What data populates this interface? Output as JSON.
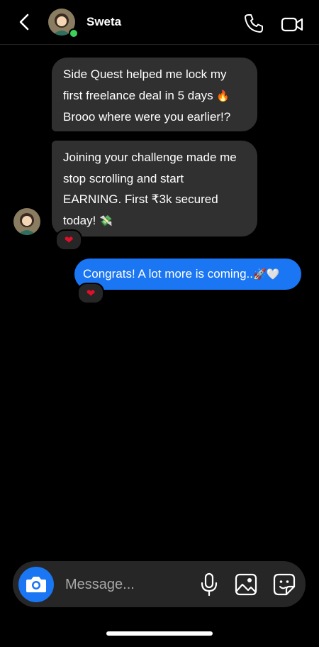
{
  "header": {
    "contact_name": "Sweta"
  },
  "messages": [
    {
      "lines": [
        "Side Quest helped me lock my",
        "first freelance deal in 5 days",
        "Brooo where were you earlier!?"
      ],
      "emoji_line1": "🔥"
    },
    {
      "lines": [
        "Joining your challenge made me",
        "stop scrolling and start",
        "EARNING. First ₹3k secured",
        "today!"
      ],
      "emoji_last": "💸",
      "reaction": "❤"
    },
    {
      "text": "Congrats! A lot more is coming..",
      "emoji": "🚀🤍",
      "reaction": "❤"
    }
  ],
  "composer": {
    "placeholder": "Message..."
  },
  "colors": {
    "accent": "#1a76f2",
    "incoming_bubble": "#303030",
    "online": "#3ed15a"
  }
}
